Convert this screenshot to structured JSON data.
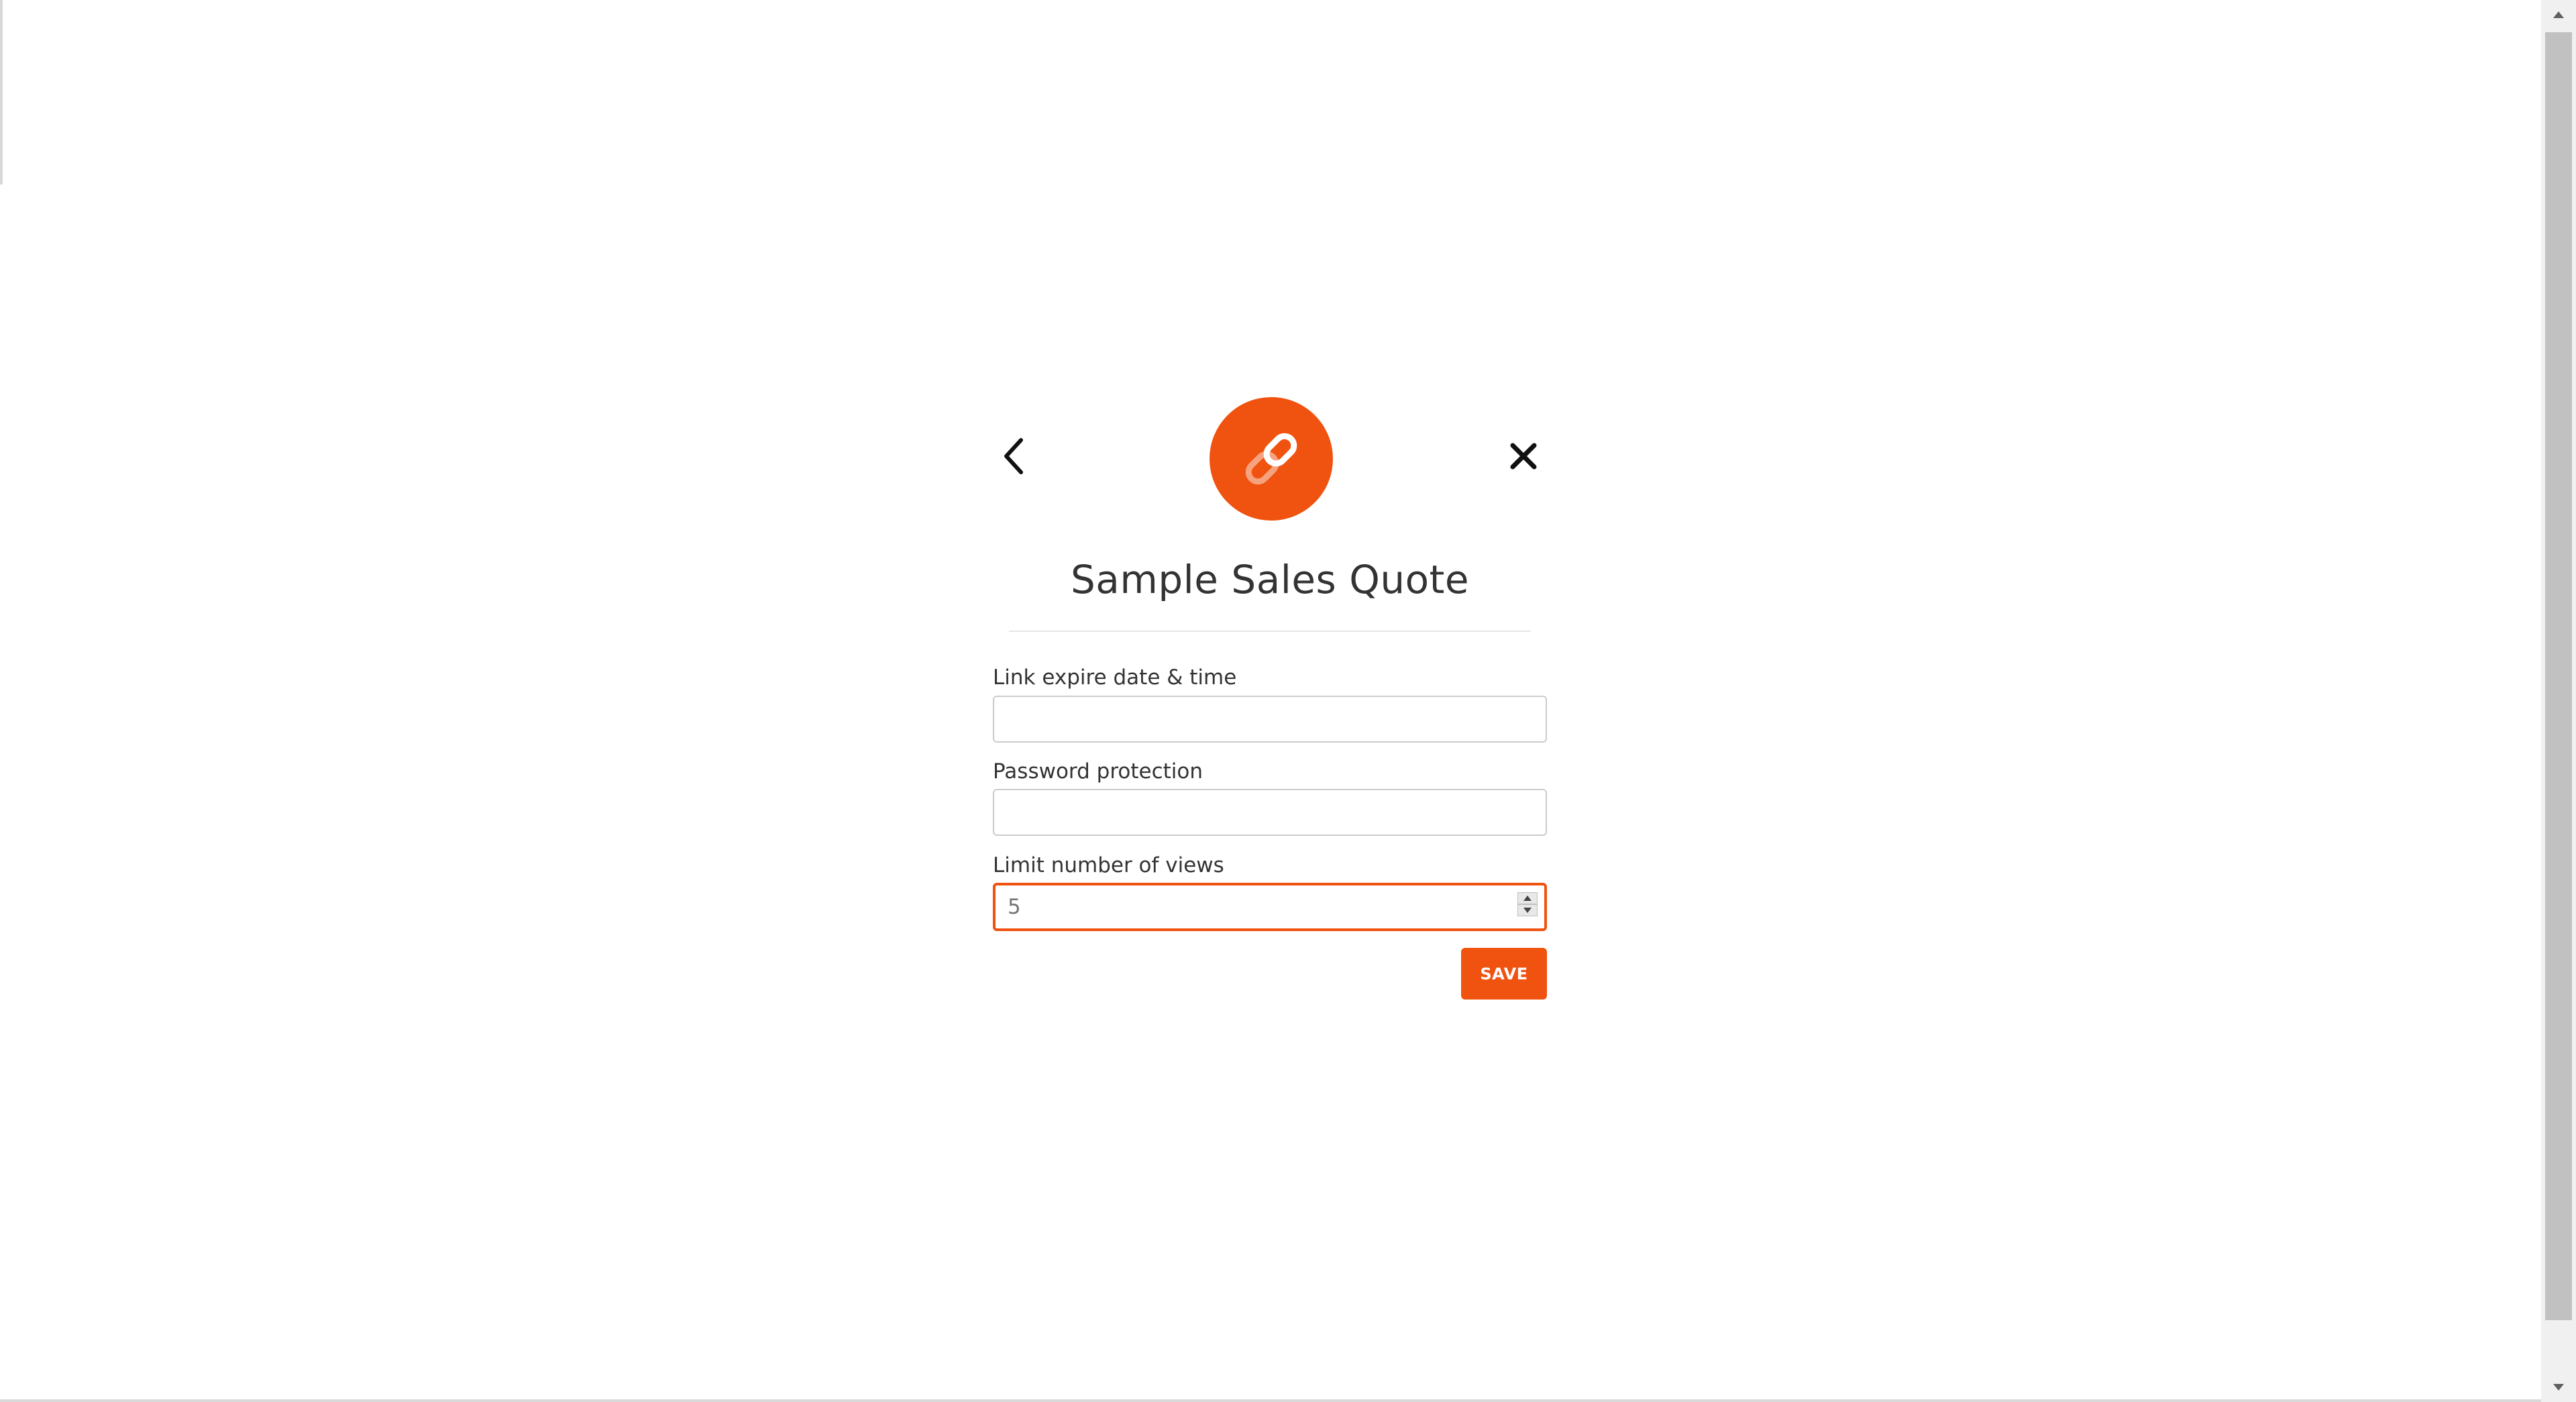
{
  "dialog": {
    "title": "Sample Sales Quote",
    "back_icon": "chevron-left-icon",
    "close_icon": "close-icon",
    "badge_icon": "link-icon",
    "accent_color": "#f0520f"
  },
  "fields": [
    {
      "label": "Link expire date & time",
      "value": "",
      "placeholder": ""
    },
    {
      "label": "Password protection",
      "value": "",
      "placeholder": ""
    },
    {
      "label": "Limit number of views",
      "value": "",
      "placeholder": "5"
    }
  ],
  "actions": {
    "save_label": "SAVE"
  }
}
